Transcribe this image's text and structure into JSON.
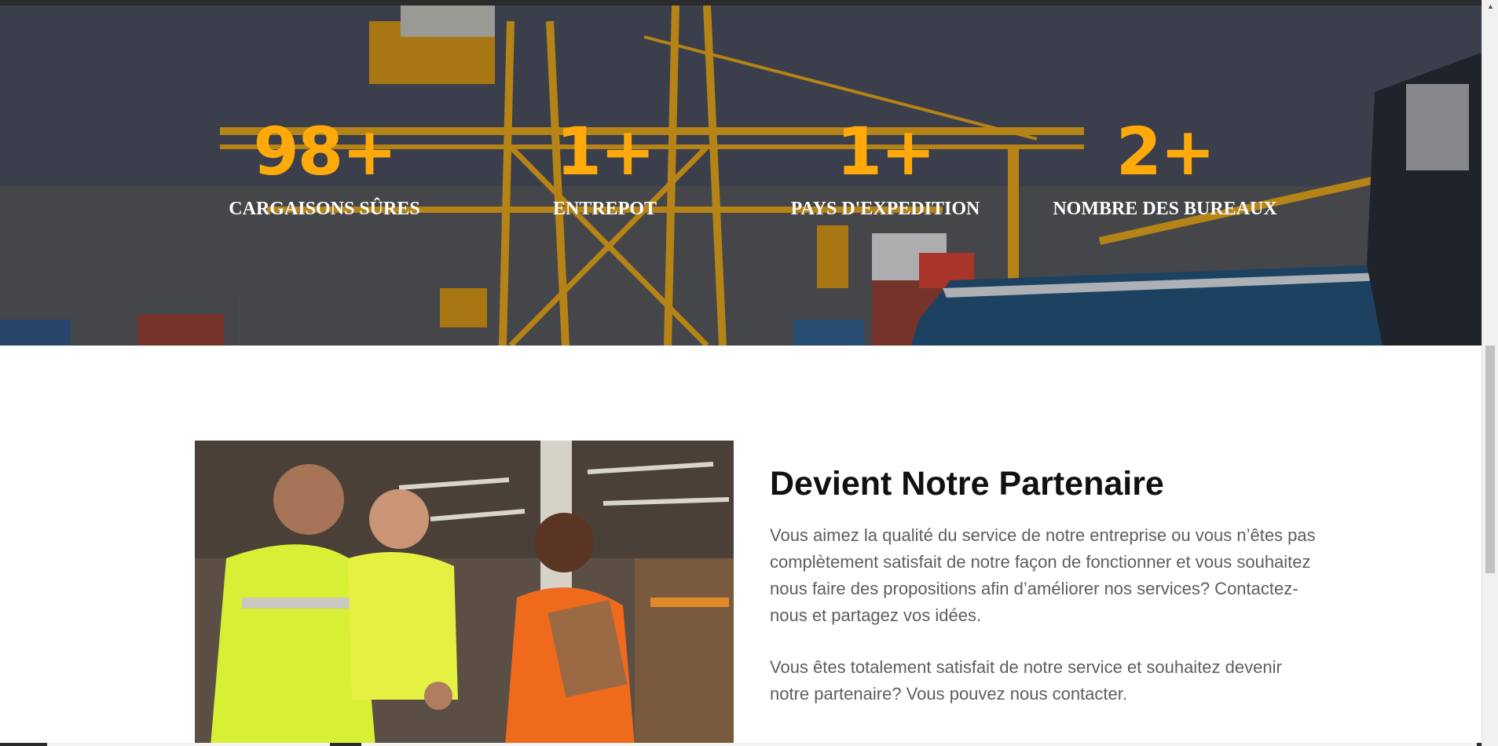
{
  "stats": [
    {
      "number": "98+",
      "label": "CARGAISONS SÛRES"
    },
    {
      "number": "1+",
      "label": "ENTREPOT"
    },
    {
      "number": "1+",
      "label": "PAYS D'EXPEDITION"
    },
    {
      "number": "2+",
      "label": "NOMBRE DES BUREAUX"
    }
  ],
  "partner": {
    "title": "Devient Notre Partenaire",
    "paragraph1": "Vous aimez la qualité du service de notre entreprise ou vous n’êtes pas complètement satisfait de notre façon de fonctionner et vous souhaitez nous faire des propositions afin d’améliorer nos services? Contactez-nous et partagez vos idées.",
    "paragraph2": "Vous êtes totalement satisfait de notre service et souhaitez devenir notre partenaire? Vous pouvez nous contacter."
  },
  "colors": {
    "accent": "#ffa90a",
    "heading": "#111111",
    "body_text": "#5e5e5e"
  },
  "icons": {
    "scroll_up": "caret-up-icon"
  }
}
